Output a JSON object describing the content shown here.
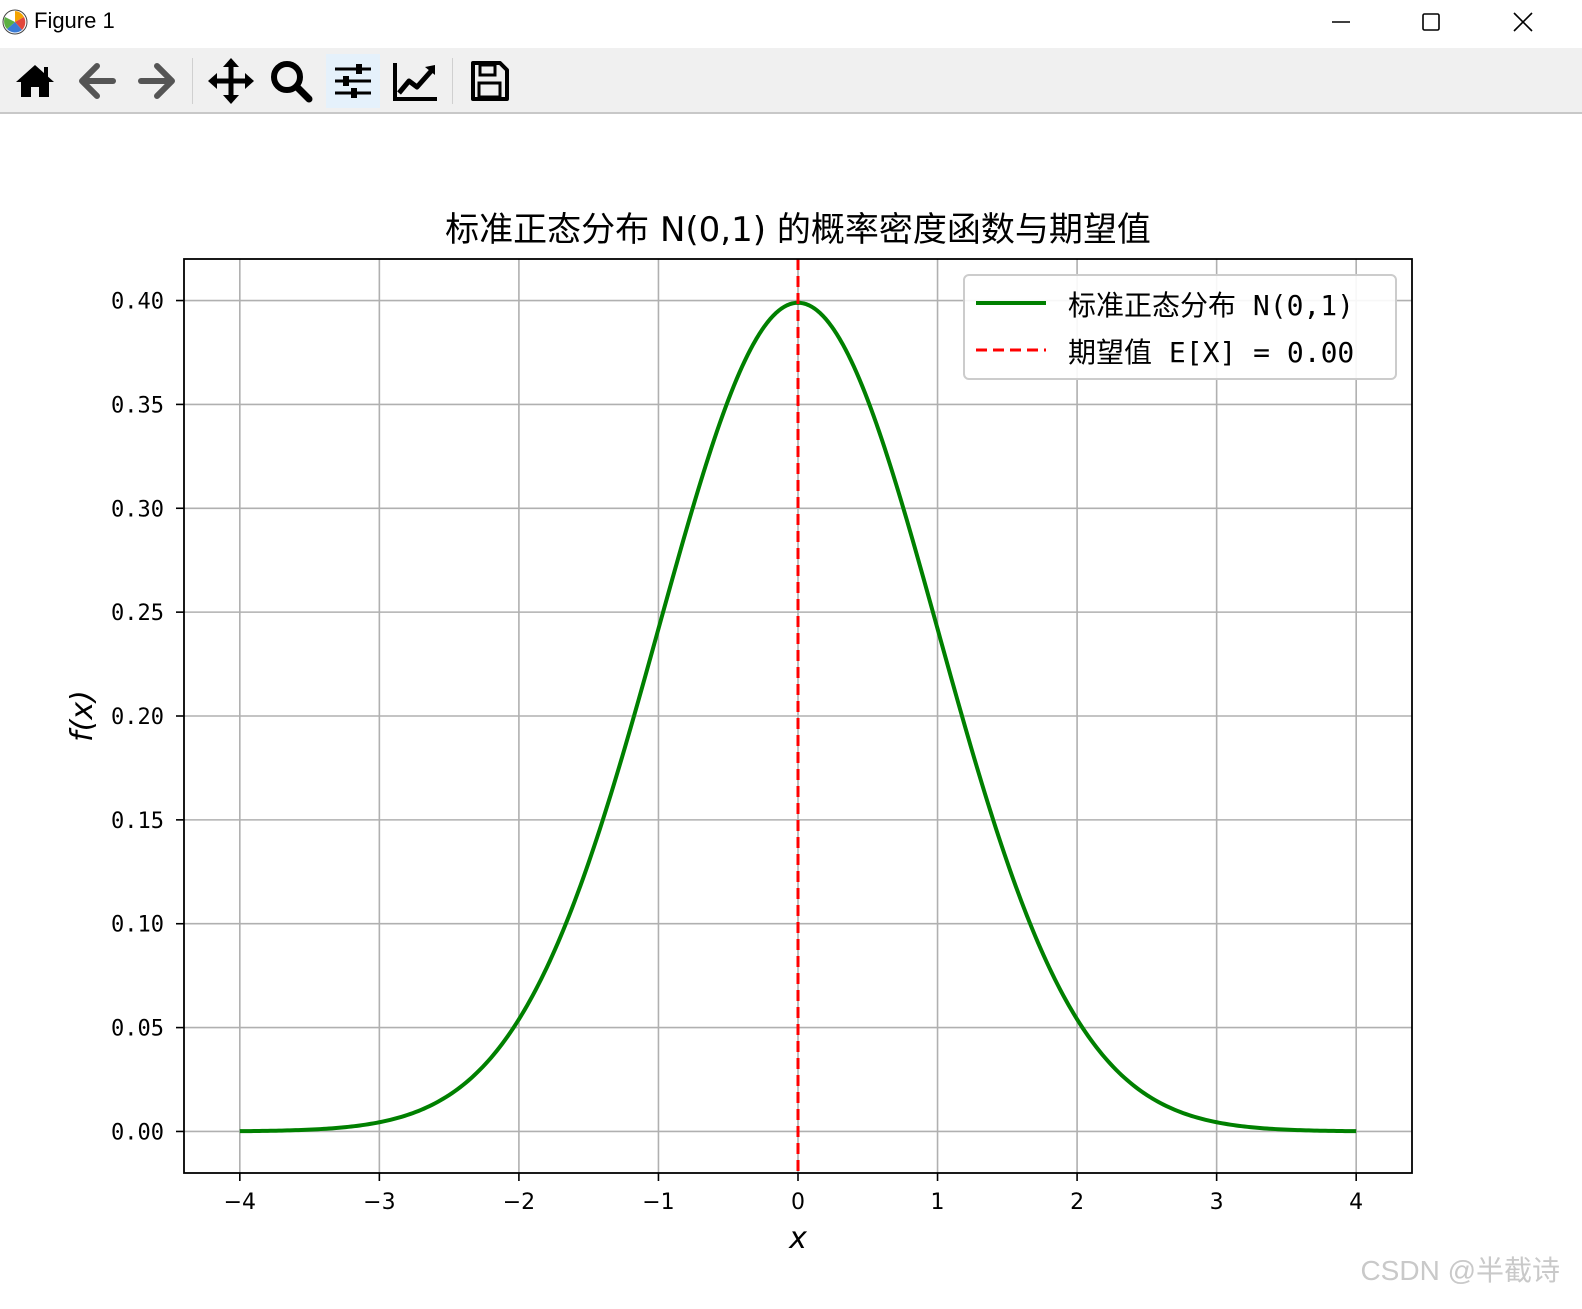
{
  "window": {
    "title": "Figure 1",
    "controls": [
      "minimize",
      "maximize",
      "close"
    ]
  },
  "toolbar": {
    "tools": [
      {
        "name": "home-icon",
        "label": "Home"
      },
      {
        "name": "back-arrow-icon",
        "label": "Back"
      },
      {
        "name": "forward-arrow-icon",
        "label": "Forward"
      },
      {
        "name": "pan-move-icon",
        "label": "Pan"
      },
      {
        "name": "zoom-magnifier-icon",
        "label": "Zoom"
      },
      {
        "name": "configure-subplots-icon",
        "label": "Subplots"
      },
      {
        "name": "edit-axis-icon",
        "label": "Customize"
      },
      {
        "name": "save-floppy-icon",
        "label": "Save"
      }
    ],
    "active_tool": "configure-subplots-icon"
  },
  "watermark": "CSDN @半截诗",
  "chart_data": {
    "type": "line",
    "title": "标准正态分布 N(0,1) 的概率密度函数与期望值",
    "xlabel": "x",
    "ylabel": "f(x)",
    "xlim": [
      -4.4,
      4.4
    ],
    "ylim": [
      -0.02,
      0.42
    ],
    "xticks": [
      -4,
      -3,
      -2,
      -1,
      0,
      1,
      2,
      3,
      4
    ],
    "xtick_labels": [
      "−4",
      "−3",
      "−2",
      "−1",
      "0",
      "1",
      "2",
      "3",
      "4"
    ],
    "yticks": [
      0.0,
      0.05,
      0.1,
      0.15,
      0.2,
      0.25,
      0.3,
      0.35,
      0.4
    ],
    "ytick_labels": [
      "0.00",
      "0.05",
      "0.10",
      "0.15",
      "0.20",
      "0.25",
      "0.30",
      "0.35",
      "0.40"
    ],
    "grid": true,
    "legend_position": "upper-right",
    "series": [
      {
        "name": "标准正态分布 N(0,1)",
        "color": "#008000",
        "style": "solid",
        "x": [
          -4.0,
          -3.5,
          -3.0,
          -2.5,
          -2.0,
          -1.5,
          -1.0,
          -0.5,
          0.0,
          0.5,
          1.0,
          1.5,
          2.0,
          2.5,
          3.0,
          3.5,
          4.0
        ],
        "y": [
          0.0001,
          0.0009,
          0.0044,
          0.0175,
          0.054,
          0.1295,
          0.242,
          0.3521,
          0.3989,
          0.3521,
          0.242,
          0.1295,
          0.054,
          0.0175,
          0.0044,
          0.0009,
          0.0001
        ]
      },
      {
        "name": "期望值 E[X] = 0.00",
        "color": "#ff0000",
        "style": "dashed",
        "vertical_line_x": 0.0
      }
    ]
  }
}
